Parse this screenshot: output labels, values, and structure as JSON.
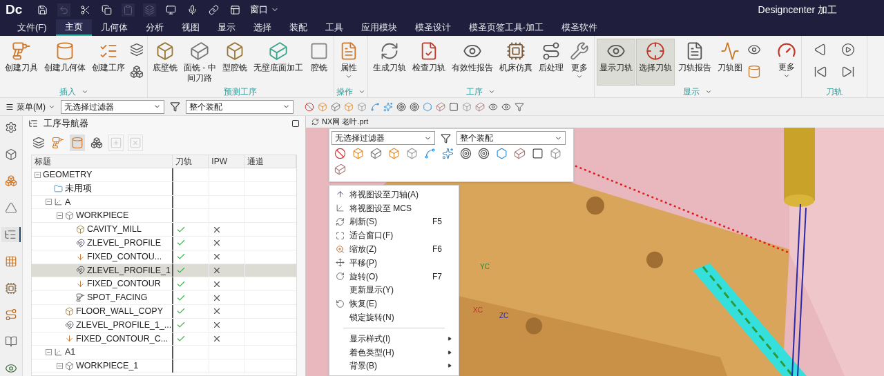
{
  "title_bar": {
    "logo": "Dc",
    "quick_tools": [
      {
        "kind": "save",
        "disabled": false
      },
      {
        "kind": "undo",
        "disabled": true
      },
      {
        "kind": "cut",
        "disabled": false
      },
      {
        "kind": "copy",
        "disabled": false
      },
      {
        "kind": "paste",
        "disabled": true
      },
      {
        "kind": "duplicate",
        "disabled": true
      },
      {
        "kind": "display",
        "disabled": false
      },
      {
        "kind": "mic",
        "disabled": false
      },
      {
        "kind": "link",
        "disabled": false
      },
      {
        "kind": "windows",
        "disabled": false
      }
    ],
    "window_menu": "窗口",
    "app_title": "Designcenter 加工"
  },
  "menu_tabs": [
    {
      "label": "文件(F)",
      "selected": false
    },
    {
      "label": "主页",
      "selected": true
    },
    {
      "label": "几何体",
      "selected": false
    },
    {
      "label": "分析",
      "selected": false
    },
    {
      "label": "视图",
      "selected": false
    },
    {
      "label": "显示",
      "selected": false
    },
    {
      "label": "选择",
      "selected": false
    },
    {
      "label": "装配",
      "selected": false
    },
    {
      "label": "工具",
      "selected": false
    },
    {
      "label": "应用模块",
      "selected": false
    },
    {
      "label": "模圣设计",
      "selected": false
    },
    {
      "label": "模圣页签工具-加工",
      "selected": false
    },
    {
      "label": "模圣软件",
      "selected": false
    }
  ],
  "ribbon": {
    "groups": [
      {
        "label": "插入",
        "has_menu": true,
        "buttons": [
          {
            "label": "创建刀具",
            "kind": "tool"
          },
          {
            "label": "创建几何体",
            "kind": "geometry"
          },
          {
            "label": "创建工序",
            "kind": "operation"
          }
        ],
        "small_tools": [
          {
            "kind": "program"
          },
          {
            "kind": "method"
          }
        ]
      },
      {
        "label": "预测工序",
        "has_menu": false,
        "buttons": [
          {
            "label": "底壁铣",
            "kind": "floor"
          },
          {
            "lines": [
              "面铣 - 中",
              "间刀路"
            ],
            "kind": "face"
          },
          {
            "label": "型腔铣",
            "kind": "cavity"
          },
          {
            "label": "无壁底面加工",
            "kind": "plane"
          },
          {
            "label": "腔铣",
            "kind": "pocket"
          }
        ]
      },
      {
        "label": "操作",
        "has_menu": true,
        "buttons": [
          {
            "label": "属性",
            "kind": "properties",
            "has_menu": true
          }
        ]
      },
      {
        "label": "工序",
        "has_menu": true,
        "buttons": [
          {
            "label": "生成刀轨",
            "kind": "generate",
            "has_menu": false
          },
          {
            "label": "检查刀轨",
            "kind": "verify",
            "has_menu": false
          },
          {
            "label": "有效性报告",
            "kind": "report",
            "has_menu": false
          },
          {
            "label": "机床仿真",
            "kind": "machine",
            "has_menu": false
          },
          {
            "label": "后处理",
            "kind": "post",
            "has_menu": false
          },
          {
            "label": "更多",
            "kind": "more",
            "has_menu": true
          }
        ]
      },
      {
        "label": "显示",
        "has_menu": true,
        "buttons": [
          {
            "label": "显示刀轨",
            "kind": "show",
            "on": true
          },
          {
            "label": "选择刀轨",
            "kind": "select",
            "on": true
          },
          {
            "label": "刀轨报告",
            "kind": "pathreport",
            "on": false
          },
          {
            "label": "刀轨图",
            "kind": "graph",
            "on": false
          }
        ],
        "small_tools": [
          {
            "kind": "shade"
          },
          {
            "kind": "cutter"
          }
        ],
        "more": "更多"
      },
      {
        "label": "刀轨",
        "has_menu": false,
        "small_tools": [
          {
            "kind": "prev"
          },
          {
            "kind": "next"
          },
          {
            "kind": "first"
          },
          {
            "kind": "last"
          }
        ]
      }
    ]
  },
  "selection_bar": {
    "menu": "菜单(M)",
    "type_filter": "无选择过滤器",
    "scope": "整个装配",
    "tools": [
      {
        "kind": "none"
      },
      {
        "kind": "solid"
      },
      {
        "kind": "face"
      },
      {
        "kind": "solid"
      },
      {
        "kind": "sheet"
      },
      {
        "kind": "curve"
      },
      {
        "kind": "points"
      },
      {
        "kind": "snap"
      },
      {
        "kind": "snap"
      },
      {
        "kind": "hexagon"
      },
      {
        "kind": "body"
      },
      {
        "kind": "square"
      },
      {
        "kind": "sheet"
      },
      {
        "kind": "body"
      },
      {
        "kind": "view"
      },
      {
        "kind": "view"
      },
      {
        "kind": "mask"
      }
    ]
  },
  "side_tabs": [
    {
      "kind": "settings",
      "selected": false
    },
    {
      "kind": "part",
      "selected": false
    },
    {
      "kind": "assembly",
      "selected": false
    },
    {
      "kind": "feature",
      "selected": false
    },
    {
      "kind": "navigator",
      "selected": true
    },
    {
      "kind": "table",
      "selected": false
    },
    {
      "kind": "machine",
      "selected": false
    },
    {
      "kind": "path",
      "selected": false
    },
    {
      "kind": "library",
      "selected": false
    },
    {
      "kind": "eye",
      "selected": false
    }
  ],
  "navigator": {
    "title": "工序导航器",
    "tools": [
      {
        "kind": "program",
        "disabled": false
      },
      {
        "kind": "tool",
        "disabled": false
      },
      {
        "kind": "geometry",
        "disabled": false
      },
      {
        "kind": "method",
        "disabled": false
      },
      {
        "kind": "add",
        "disabled": true
      },
      {
        "kind": "remove",
        "disabled": true
      }
    ],
    "columns": [
      "标题",
      "刀轨",
      "IPW",
      "通道"
    ],
    "tree": [
      {
        "label": "GEOMETRY",
        "selected": false,
        "expanded": true,
        "children": [
          {
            "label": "未用项",
            "kind": "folder",
            "selected": false
          },
          {
            "label": "A",
            "kind": "mcs",
            "selected": false,
            "expanded": true,
            "children": [
              {
                "label": "WORKPIECE",
                "kind": "workpiece",
                "selected": false,
                "expanded": true,
                "children": [
                  {
                    "label": "CAVITY_MILL",
                    "kind": "cavity",
                    "selected": false,
                    "toolpath_ok": true,
                    "ipw_ok": false
                  },
                  {
                    "label": "ZLEVEL_PROFILE",
                    "kind": "zlevel",
                    "selected": false,
                    "toolpath_ok": true,
                    "ipw_ok": false
                  },
                  {
                    "label": "FIXED_CONTOU...",
                    "kind": "contour",
                    "selected": false,
                    "toolpath_ok": true,
                    "ipw_ok": false
                  },
                  {
                    "label": "ZLEVEL_PROFILE_1",
                    "kind": "zlevel",
                    "selected": true,
                    "toolpath_ok": true,
                    "ipw_ok": false
                  },
                  {
                    "label": "FIXED_CONTOUR",
                    "kind": "contour",
                    "selected": false,
                    "toolpath_ok": true,
                    "ipw_ok": false
                  },
                  {
                    "label": "SPOT_FACING",
                    "kind": "spot",
                    "selected": false,
                    "toolpath_ok": true,
                    "ipw_ok": false
                  }
                ]
              },
              {
                "label": "FLOOR_WALL_COPY",
                "kind": "floor",
                "selected": false,
                "toolpath_ok": true,
                "ipw_ok": false
              },
              {
                "label": "ZLEVEL_PROFILE_1_...",
                "kind": "zlevel",
                "selected": false,
                "toolpath_ok": true,
                "ipw_ok": false
              },
              {
                "label": "FIXED_CONTOUR_C...",
                "kind": "contour",
                "selected": false,
                "toolpath_ok": true,
                "ipw_ok": false
              }
            ]
          },
          {
            "label": "A1",
            "kind": "mcs",
            "selected": false,
            "expanded": true,
            "children": [
              {
                "label": "WORKPIECE_1",
                "kind": "workpiece",
                "selected": false,
                "expanded": true
              }
            ]
          }
        ]
      }
    ]
  },
  "viewport": {
    "tab": "NX网 老叶.prt",
    "axis_labels": [
      "YC",
      "XC",
      "ZC"
    ],
    "filter_popup": {
      "type_filter": "无选择过滤器",
      "scope": "整个装配",
      "tools": [
        {
          "kind": "none"
        },
        {
          "kind": "solid"
        },
        {
          "kind": "face"
        },
        {
          "kind": "solid"
        },
        {
          "kind": "sheet"
        },
        {
          "kind": "curve"
        },
        {
          "kind": "points"
        },
        {
          "kind": "snap"
        },
        {
          "kind": "snap"
        },
        {
          "kind": "hexagon"
        },
        {
          "kind": "body"
        },
        {
          "kind": "square"
        },
        {
          "kind": "sheet"
        },
        {
          "kind": "body"
        }
      ]
    },
    "context_menu": [
      {
        "kind": "axis",
        "label": "将视图设至刀轴(A)"
      },
      {
        "kind": "mcs",
        "label": "将视图设至 MCS"
      },
      {
        "kind": "refresh",
        "label": "刷新(S)",
        "shortcut": "F5"
      },
      {
        "kind": "fit",
        "label": "适合窗口(F)"
      },
      {
        "kind": "zoom",
        "label": "缩放(Z)",
        "shortcut": "F6"
      },
      {
        "kind": "pan",
        "label": "平移(P)"
      },
      {
        "kind": "rotate",
        "label": "旋转(O)",
        "shortcut": "F7"
      },
      {
        "kind": "command",
        "label": "更新显示(Y)"
      },
      {
        "kind": "restore",
        "label": "恢复(E)"
      },
      {
        "kind": "command",
        "label": "锁定旋转(N)"
      },
      {
        "kind": "separator"
      },
      {
        "kind": "submenu",
        "label": "显示样式(I)"
      },
      {
        "kind": "submenu",
        "label": "着色类型(H)"
      },
      {
        "kind": "submenu",
        "label": "背景(B)"
      }
    ]
  }
}
